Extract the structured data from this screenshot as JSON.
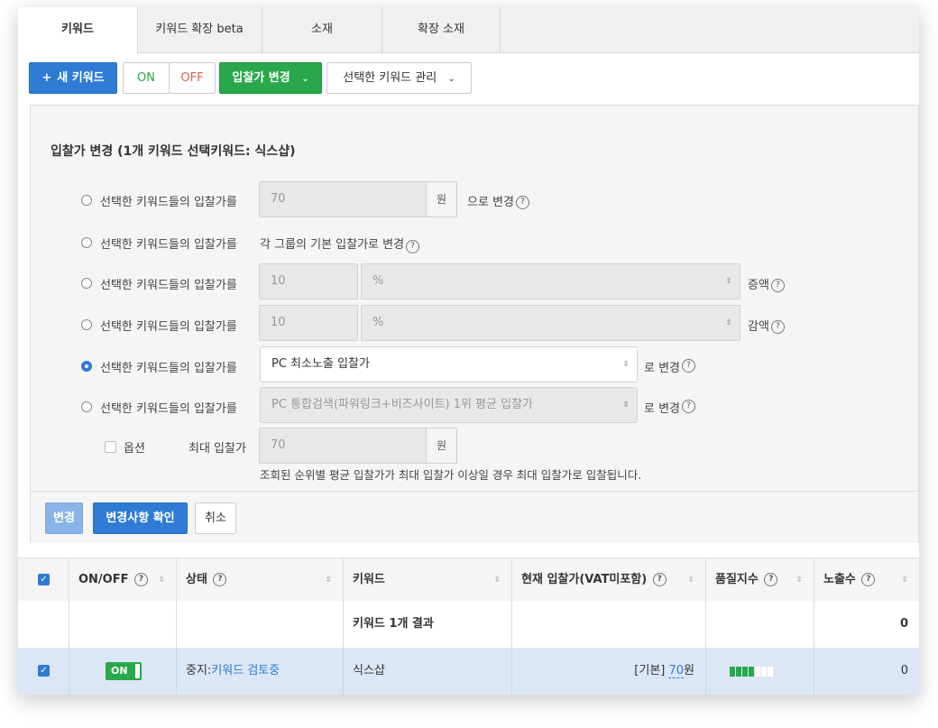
{
  "tabs": [
    "키워드",
    "키워드 확장 beta",
    "소재",
    "확장 소재"
  ],
  "toolbar": {
    "new_keyword": "새 키워드",
    "on": "ON",
    "off": "OFF",
    "bid_change": "입찰가 변경",
    "manage_selected": "선택한 키워드 관리"
  },
  "panel": {
    "title": "입찰가 변경 (1개 키워드 선택키워드: 식스샵)",
    "rows": [
      {
        "label": "선택한 키워드들의 입찰가를",
        "value": "70",
        "unit": "원",
        "suffix": "으로 변경"
      },
      {
        "label": "선택한 키워드들의 입찰가를",
        "suffix": "각 그룹의 기본 입찰가로 변경"
      },
      {
        "label": "선택한 키워드들의 입찰가를",
        "value": "10",
        "unit": "%",
        "suffix": "증액"
      },
      {
        "label": "선택한 키워드들의 입찰가를",
        "value": "10",
        "unit": "%",
        "suffix": "감액"
      },
      {
        "label": "선택한 키워드들의 입찰가를",
        "select": "PC 최소노출 입찰가",
        "suffix": "로 변경"
      },
      {
        "label": "선택한 키워드들의 입찰가를",
        "select": "PC 통합검색(파워링크+비즈사이트) 1위 평균 입찰가",
        "suffix": "로 변경"
      }
    ],
    "option_label": "옵션",
    "max_bid_label": "최대 입찰가",
    "max_bid_value": "70",
    "max_bid_unit": "원",
    "note": "조회된 순위별 평균 입찰가가 최대 입찰가 이상일 경우 최대 입찰가로 입찰됩니다.",
    "help": "?",
    "buttons": {
      "change": "변경",
      "confirm": "변경사항 확인",
      "cancel": "취소"
    }
  },
  "table": {
    "headers": [
      "ON/OFF",
      "상태",
      "키워드",
      "현재 입찰가(VAT미포함)",
      "품질지수",
      "노출수"
    ],
    "summary": {
      "keyword": "키워드 1개 결과",
      "impressions": "0"
    },
    "row": {
      "toggle": "ON",
      "status_prefix": "중지:",
      "status_link": "키워드 검토중",
      "keyword": "식스샵",
      "bid_prefix": "[기본] ",
      "bid_value": "70",
      "bid_unit": "원",
      "quality": 4,
      "quality_max": 7,
      "impressions": "0"
    }
  },
  "colors": {
    "accent": "#2f7bd6",
    "green": "#28a84a",
    "off": "#e05a4f"
  }
}
